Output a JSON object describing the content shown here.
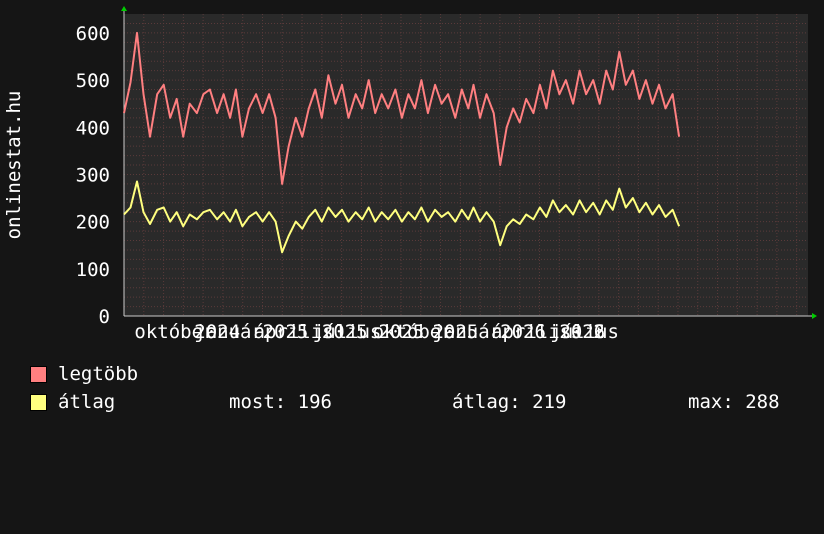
{
  "colors": {
    "background": "#151515",
    "canvas": "#2a2a2a",
    "grid": "#5a3a3a",
    "axis": "#ffffff",
    "legtobb": "#ff7f80",
    "atlag": "#ffff7f",
    "arrow": "#00cc00"
  },
  "chart_data": {
    "type": "line",
    "ylabel": "onlinestat.hu",
    "ylim": [
      0,
      640
    ],
    "yticks": [
      0,
      100,
      200,
      300,
      400,
      500,
      600
    ],
    "x_start": "2023-09-15",
    "x_end": "2026-08-01",
    "xticks": [
      {
        "label": "október",
        "date": "2023-10-01"
      },
      {
        "label": "január",
        "date": "2024-01-01"
      },
      {
        "label": "2024",
        "date": "2024-01-01"
      },
      {
        "label": "április",
        "date": "2024-04-01"
      },
      {
        "label": "2025",
        "date": "2024-04-15"
      },
      {
        "label": "július",
        "date": "2024-07-01"
      },
      {
        "label": "2025",
        "date": "2024-07-15"
      },
      {
        "label": "október",
        "date": "2024-10-01"
      },
      {
        "label": "2025",
        "date": "2024-10-10"
      },
      {
        "label": "január",
        "date": "2025-01-01"
      },
      {
        "label": "2025",
        "date": "2025-01-01"
      },
      {
        "label": "április",
        "date": "2025-04-01"
      },
      {
        "label": "2026",
        "date": "2025-04-15"
      },
      {
        "label": "július",
        "date": "2025-07-01"
      },
      {
        "label": "2026",
        "date": "2025-07-15"
      },
      {
        "label": "s 2",
        "date": "2025-08-01"
      }
    ],
    "grid": true,
    "series": [
      {
        "name": "legtöbb",
        "color": "#ff7f80",
        "points": [
          [
            "2023-09-15",
            430
          ],
          [
            "2023-09-25",
            495
          ],
          [
            "2023-10-05",
            600
          ],
          [
            "2023-10-15",
            470
          ],
          [
            "2023-10-25",
            380
          ],
          [
            "2023-11-05",
            470
          ],
          [
            "2023-11-15",
            490
          ],
          [
            "2023-11-25",
            420
          ],
          [
            "2023-12-05",
            460
          ],
          [
            "2023-12-15",
            380
          ],
          [
            "2023-12-25",
            450
          ],
          [
            "2024-01-05",
            430
          ],
          [
            "2024-01-15",
            470
          ],
          [
            "2024-01-25",
            480
          ],
          [
            "2024-02-05",
            430
          ],
          [
            "2024-02-15",
            470
          ],
          [
            "2024-02-25",
            420
          ],
          [
            "2024-03-05",
            480
          ],
          [
            "2024-03-15",
            380
          ],
          [
            "2024-03-25",
            440
          ],
          [
            "2024-04-05",
            470
          ],
          [
            "2024-04-15",
            430
          ],
          [
            "2024-04-25",
            470
          ],
          [
            "2024-05-05",
            420
          ],
          [
            "2024-05-15",
            280
          ],
          [
            "2024-05-25",
            360
          ],
          [
            "2024-06-05",
            420
          ],
          [
            "2024-06-15",
            380
          ],
          [
            "2024-06-25",
            440
          ],
          [
            "2024-07-05",
            480
          ],
          [
            "2024-07-15",
            420
          ],
          [
            "2024-07-25",
            510
          ],
          [
            "2024-08-05",
            450
          ],
          [
            "2024-08-15",
            490
          ],
          [
            "2024-08-25",
            420
          ],
          [
            "2024-09-05",
            470
          ],
          [
            "2024-09-15",
            440
          ],
          [
            "2024-09-25",
            500
          ],
          [
            "2024-10-05",
            430
          ],
          [
            "2024-10-15",
            470
          ],
          [
            "2024-10-25",
            440
          ],
          [
            "2024-11-05",
            480
          ],
          [
            "2024-11-15",
            420
          ],
          [
            "2024-11-25",
            470
          ],
          [
            "2024-12-05",
            440
          ],
          [
            "2024-12-15",
            500
          ],
          [
            "2024-12-25",
            430
          ],
          [
            "2025-01-05",
            490
          ],
          [
            "2025-01-15",
            450
          ],
          [
            "2025-01-25",
            470
          ],
          [
            "2025-02-05",
            420
          ],
          [
            "2025-02-15",
            480
          ],
          [
            "2025-02-25",
            440
          ],
          [
            "2025-03-05",
            490
          ],
          [
            "2025-03-15",
            420
          ],
          [
            "2025-03-25",
            470
          ],
          [
            "2025-04-05",
            430
          ],
          [
            "2025-04-15",
            320
          ],
          [
            "2025-04-25",
            400
          ],
          [
            "2025-05-05",
            440
          ],
          [
            "2025-05-15",
            410
          ],
          [
            "2025-05-25",
            460
          ],
          [
            "2025-06-05",
            430
          ],
          [
            "2025-06-15",
            490
          ],
          [
            "2025-06-25",
            440
          ],
          [
            "2025-07-05",
            520
          ],
          [
            "2025-07-15",
            470
          ],
          [
            "2025-07-25",
            500
          ],
          [
            "2025-08-05",
            450
          ],
          [
            "2025-08-15",
            520
          ],
          [
            "2025-08-25",
            470
          ],
          [
            "2025-09-05",
            500
          ],
          [
            "2025-09-15",
            450
          ],
          [
            "2025-09-25",
            520
          ],
          [
            "2025-10-05",
            480
          ],
          [
            "2025-10-15",
            560
          ],
          [
            "2025-10-25",
            490
          ],
          [
            "2025-11-05",
            520
          ],
          [
            "2025-11-15",
            460
          ],
          [
            "2025-11-25",
            500
          ],
          [
            "2025-12-05",
            450
          ],
          [
            "2025-12-15",
            490
          ],
          [
            "2025-12-25",
            440
          ],
          [
            "2026-01-05",
            470
          ],
          [
            "2026-01-15",
            380
          ]
        ]
      },
      {
        "name": "átlag",
        "color": "#ffff7f",
        "points": [
          [
            "2023-09-15",
            215
          ],
          [
            "2023-09-25",
            230
          ],
          [
            "2023-10-05",
            285
          ],
          [
            "2023-10-15",
            220
          ],
          [
            "2023-10-25",
            195
          ],
          [
            "2023-11-05",
            225
          ],
          [
            "2023-11-15",
            230
          ],
          [
            "2023-11-25",
            200
          ],
          [
            "2023-12-05",
            220
          ],
          [
            "2023-12-15",
            190
          ],
          [
            "2023-12-25",
            215
          ],
          [
            "2024-01-05",
            205
          ],
          [
            "2024-01-15",
            220
          ],
          [
            "2024-01-25",
            225
          ],
          [
            "2024-02-05",
            205
          ],
          [
            "2024-02-15",
            220
          ],
          [
            "2024-02-25",
            200
          ],
          [
            "2024-03-05",
            225
          ],
          [
            "2024-03-15",
            190
          ],
          [
            "2024-03-25",
            210
          ],
          [
            "2024-04-05",
            220
          ],
          [
            "2024-04-15",
            200
          ],
          [
            "2024-04-25",
            220
          ],
          [
            "2024-05-05",
            200
          ],
          [
            "2024-05-15",
            135
          ],
          [
            "2024-05-25",
            170
          ],
          [
            "2024-06-05",
            200
          ],
          [
            "2024-06-15",
            185
          ],
          [
            "2024-06-25",
            210
          ],
          [
            "2024-07-05",
            225
          ],
          [
            "2024-07-15",
            200
          ],
          [
            "2024-07-25",
            230
          ],
          [
            "2024-08-05",
            210
          ],
          [
            "2024-08-15",
            225
          ],
          [
            "2024-08-25",
            200
          ],
          [
            "2024-09-05",
            220
          ],
          [
            "2024-09-15",
            205
          ],
          [
            "2024-09-25",
            230
          ],
          [
            "2024-10-05",
            200
          ],
          [
            "2024-10-15",
            220
          ],
          [
            "2024-10-25",
            205
          ],
          [
            "2024-11-05",
            225
          ],
          [
            "2024-11-15",
            200
          ],
          [
            "2024-11-25",
            220
          ],
          [
            "2024-12-05",
            205
          ],
          [
            "2024-12-15",
            230
          ],
          [
            "2024-12-25",
            200
          ],
          [
            "2025-01-05",
            225
          ],
          [
            "2025-01-15",
            210
          ],
          [
            "2025-01-25",
            220
          ],
          [
            "2025-02-05",
            200
          ],
          [
            "2025-02-15",
            225
          ],
          [
            "2025-02-25",
            205
          ],
          [
            "2025-03-05",
            230
          ],
          [
            "2025-03-15",
            200
          ],
          [
            "2025-03-25",
            220
          ],
          [
            "2025-04-05",
            200
          ],
          [
            "2025-04-15",
            150
          ],
          [
            "2025-04-25",
            190
          ],
          [
            "2025-05-05",
            205
          ],
          [
            "2025-05-15",
            195
          ],
          [
            "2025-05-25",
            215
          ],
          [
            "2025-06-05",
            205
          ],
          [
            "2025-06-15",
            230
          ],
          [
            "2025-06-25",
            210
          ],
          [
            "2025-07-05",
            245
          ],
          [
            "2025-07-15",
            220
          ],
          [
            "2025-07-25",
            235
          ],
          [
            "2025-08-05",
            215
          ],
          [
            "2025-08-15",
            245
          ],
          [
            "2025-08-25",
            220
          ],
          [
            "2025-09-05",
            240
          ],
          [
            "2025-09-15",
            215
          ],
          [
            "2025-09-25",
            245
          ],
          [
            "2025-10-05",
            225
          ],
          [
            "2025-10-15",
            270
          ],
          [
            "2025-10-25",
            230
          ],
          [
            "2025-11-05",
            250
          ],
          [
            "2025-11-15",
            220
          ],
          [
            "2025-11-25",
            240
          ],
          [
            "2025-12-05",
            215
          ],
          [
            "2025-12-15",
            235
          ],
          [
            "2025-12-25",
            210
          ],
          [
            "2026-01-05",
            225
          ],
          [
            "2026-01-15",
            190
          ]
        ]
      }
    ]
  },
  "legend": {
    "items": [
      {
        "label": "legtöbb",
        "color": "#ff7f80"
      },
      {
        "label": "átlag",
        "color": "#ffff7f"
      }
    ],
    "stats": {
      "most_label": "most:",
      "most_value": "196",
      "atlag_label": "átlag:",
      "atlag_value": "219",
      "max_label": "max:",
      "max_value": "288"
    }
  }
}
